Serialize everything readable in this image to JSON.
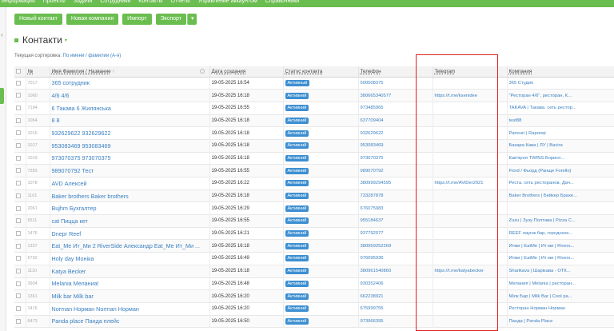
{
  "topnav": [
    "информация",
    "Проекты",
    "Задачи",
    "Сотрудники",
    "Контакты",
    "Отчеты",
    "Управление аккаунтом",
    "Справочники"
  ],
  "toolbar": {
    "new_contact": "Новый контакт",
    "new_company": "Новая компания",
    "import": "Импорт",
    "export": "Экспорт",
    "export_caret": "▾"
  },
  "page": {
    "title": "Контакти",
    "title_caret": "▾",
    "sort_label": "Текущая сортировка:",
    "sort_value": "По имени / фамилии (А-я)"
  },
  "colors": {
    "accent": "#6abd4f",
    "link": "#3a7fc0",
    "badge": "#3d8fd1",
    "highlight": "#e02020"
  },
  "table": {
    "headers": {
      "id": "№",
      "name": "Имя Фамилия / Название",
      "sort_icon": "↑",
      "date": "Дата создания",
      "status": "Статус контакта",
      "phone": "Телефон",
      "telegram": "Telegram",
      "company": "Компания"
    },
    "rows": [
      {
        "id": "7017",
        "name": "365 сотрудник",
        "date": "19-05-2025 16:54",
        "status": "Активный",
        "phone": "500508375",
        "telegram": "",
        "company": "365 Студио"
      },
      {
        "id": "1060",
        "name": "4/6 4/6",
        "date": "19-05-2025 16:18",
        "status": "Активний",
        "phone": "380665340577",
        "telegram": "https://t.me/ksenidee",
        "company": "\"Ресторан 4/6\", ресторан, К..."
      },
      {
        "id": "7194",
        "name": "6 Такава 6 Жилянська",
        "date": "19-05-2025 16:55",
        "status": "Активний",
        "phone": "973485965",
        "telegram": "",
        "company": "TAKAVA | Такава. сеть рестор..."
      },
      {
        "id": "1064",
        "name": "8 8",
        "date": "19-05-2025 16:18",
        "status": "Активний",
        "phone": "637709404",
        "telegram": "",
        "company": "test88"
      },
      {
        "id": "1016",
        "name": "932629622 932629622",
        "date": "19-05-2025 16:18",
        "status": "Активний",
        "phone": "932629622",
        "telegram": "",
        "company": "Рапонгі | Raponqi"
      },
      {
        "id": "1017",
        "name": "953083469 953083469",
        "date": "19-05-2025 16:18",
        "status": "Активний",
        "phone": "953083469",
        "telegram": "",
        "company": "Бакара Кава | ЛУ | Васіга"
      },
      {
        "id": "1019",
        "name": "973070375 973070375",
        "date": "19-05-2025 16:18",
        "status": "Активний",
        "phone": "973070375",
        "telegram": "",
        "company": "Кав'ярня TWINS Борисп..."
      },
      {
        "id": "7283",
        "name": "989070792 Тест",
        "date": "19-05-2025 16:55",
        "status": "Активний",
        "phone": "989070792",
        "telegram": "",
        "company": "Fiord / Фьорд (Ранще Forello)"
      },
      {
        "id": "1078",
        "name": "AVD Алексей",
        "date": "19-05-2025 16:22",
        "status": "Активний",
        "phone": "380999294595",
        "telegram": "https://t.me/AViDer2021",
        "company": "Реста. сеть ресторанов, Дач..."
      },
      {
        "id": "1101",
        "name": "Baker brothers Baker brothers",
        "date": "19-05-2025 16:18",
        "status": "Активний",
        "phone": "733287878",
        "telegram": "",
        "company": "Baker Brothers | Бейкер Брахе..."
      },
      {
        "id": "2061",
        "name": "Bujhm Бухгалтер",
        "date": "19-05-2025 16:29",
        "status": "Активний",
        "phone": "676075983",
        "telegram": "",
        "company": ""
      },
      {
        "id": "6511",
        "name": "cat Пицца кет",
        "date": "19-05-2025 16:55",
        "status": "Активний",
        "phone": "955184637",
        "telegram": "",
        "company": "Zuzu | Зузу Полтава | Pizza C..."
      },
      {
        "id": "1476",
        "name": "Dnepr Reef",
        "date": "19-05-2025 16:21",
        "status": "Активний",
        "phone": "937792077",
        "telegram": "",
        "company": "REEF лаунж бар, городское..."
      },
      {
        "id": "1327",
        "name": "Eat_Me Ит_Ми 2 RiverSide Александр Eat_Me Ит_Ми ...",
        "date": "19-05-2025 16:18",
        "status": "Активний",
        "phone": "380959252269",
        "telegram": "",
        "company": "Итми | EatMe | Ит ми | Rivers..."
      },
      {
        "id": "6792",
        "name": "Holy day Моніка",
        "date": "19-05-2025 16:49",
        "status": "Активний",
        "phone": "976095936",
        "telegram": "",
        "company": "Итми | EatMe | Ит ми | Rivers..."
      },
      {
        "id": "1110",
        "name": "Katya Becker",
        "date": "19-05-2025 16:18",
        "status": "Активний",
        "phone": "380961540860",
        "telegram": "https://t.me/katyabecker",
        "company": "Sharikava | Шарікава - ОТК..."
      },
      {
        "id": "3904",
        "name": "Melania Меланиа!",
        "date": "19-05-2025 16:48",
        "status": "Активний",
        "phone": "930352406",
        "telegram": "",
        "company": "Мелания | Melania | ресторан..."
      },
      {
        "id": "1361",
        "name": "Milk bar Milk bar",
        "date": "19-05-2025 16:20",
        "status": "Активний",
        "phone": "662238921",
        "telegram": "",
        "company": "Мілк Бар | Milk Bar | Cool ра..."
      },
      {
        "id": "1415",
        "name": "Norman Норман Norman Норман",
        "date": "19-05-2025 16:20",
        "status": "Активний",
        "phone": "675999755",
        "telegram": "",
        "company": "Ресторан Норман Норман"
      },
      {
        "id": "6473",
        "name": "Panda place Панда плейс",
        "date": "19-05-2025 16:50",
        "status": "Активний",
        "phone": "973966395",
        "telegram": "",
        "company": "Панда | Panda Place"
      }
    ]
  }
}
